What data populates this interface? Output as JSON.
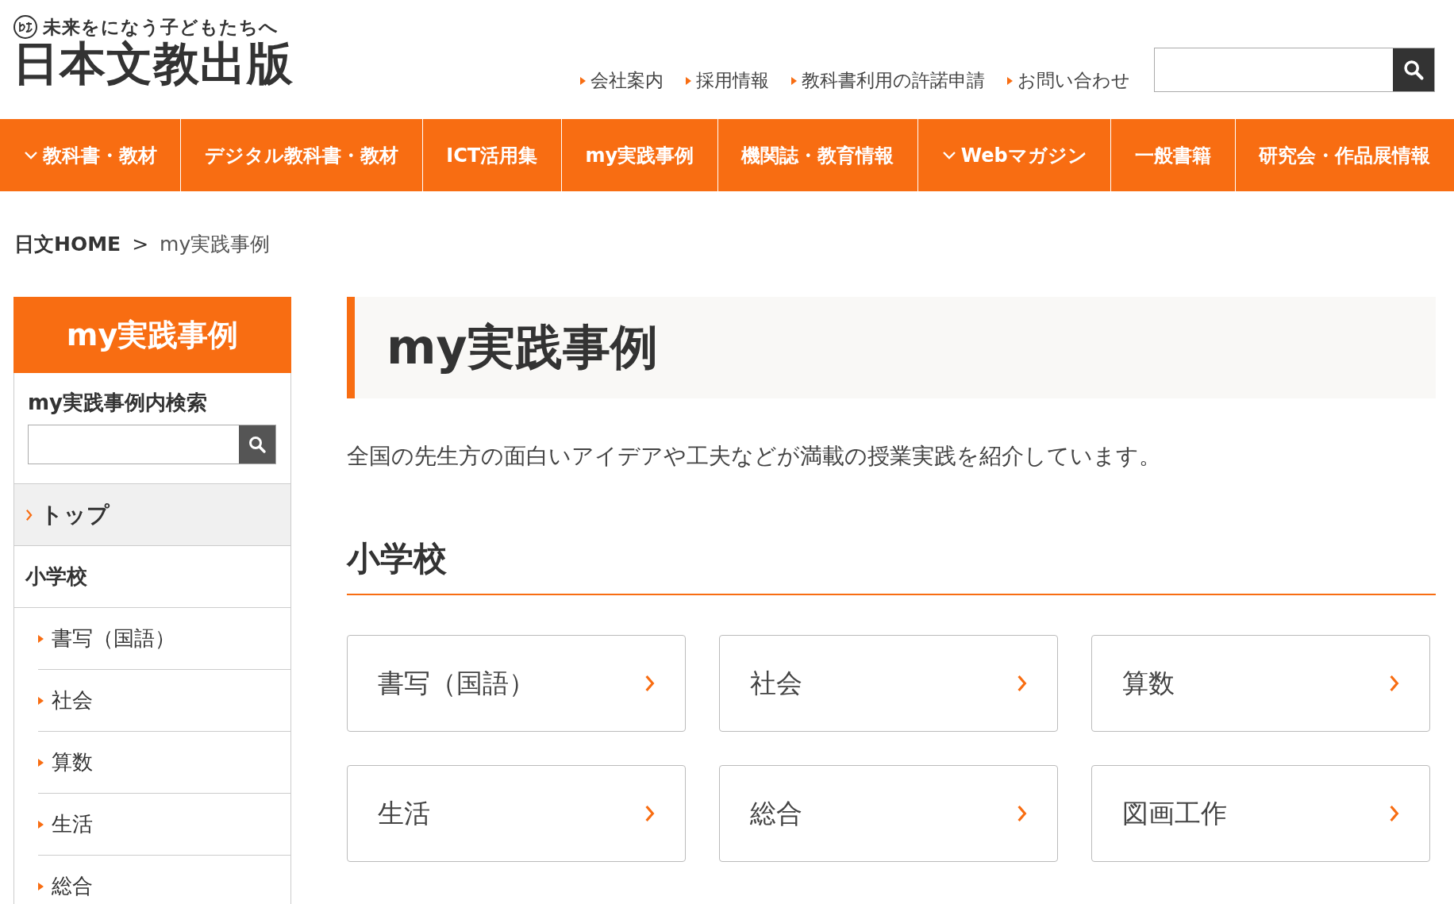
{
  "header": {
    "tagline": "未来をになう子どもたちへ",
    "logo": "日本文教出版",
    "links": [
      "会社案内",
      "採用情報",
      "教科書利用の許諾申請",
      "お問い合わせ"
    ]
  },
  "nav": [
    {
      "label": "教科書・教材",
      "has_menu": true
    },
    {
      "label": "デジタル教科書・教材",
      "has_menu": false
    },
    {
      "label": "ICT活用集",
      "has_menu": false
    },
    {
      "label": "my実践事例",
      "has_menu": false
    },
    {
      "label": "機関誌・教育情報",
      "has_menu": false
    },
    {
      "label": "Webマガジン",
      "has_menu": true
    },
    {
      "label": "一般書籍",
      "has_menu": false
    },
    {
      "label": "研究会・作品展情報",
      "has_menu": false
    }
  ],
  "breadcrumb": {
    "home": "日文HOME",
    "separator": ">",
    "current": "my実践事例"
  },
  "sidebar": {
    "title": "my実践事例",
    "search_label": "my実践事例内検索",
    "items": [
      {
        "kind": "top",
        "label": "トップ",
        "selected": true
      },
      {
        "kind": "section",
        "label": "小学校",
        "selected": false
      },
      {
        "kind": "sub",
        "label": "書写（国語）",
        "selected": false
      },
      {
        "kind": "sub",
        "label": "社会",
        "selected": false
      },
      {
        "kind": "sub",
        "label": "算数",
        "selected": false
      },
      {
        "kind": "sub",
        "label": "生活",
        "selected": false
      },
      {
        "kind": "sub",
        "label": "総合",
        "selected": false
      }
    ]
  },
  "main": {
    "title": "my実践事例",
    "description": "全国の先生方の面白いアイデアや工夫などが満載の授業実践を紹介しています。",
    "section_heading": "小学校",
    "cards": [
      "書写（国語）",
      "社会",
      "算数",
      "生活",
      "総合",
      "図画工作"
    ]
  }
}
